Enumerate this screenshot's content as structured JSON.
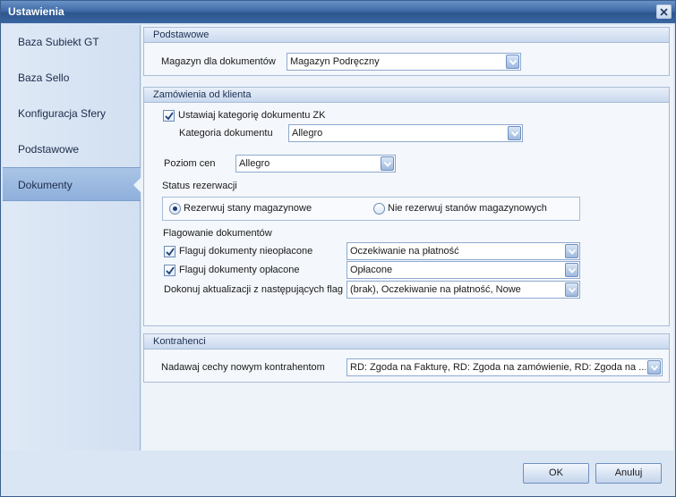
{
  "window": {
    "title": "Ustawienia"
  },
  "sidebar": {
    "items": [
      {
        "label": "Baza Subiekt GT"
      },
      {
        "label": "Baza Sello"
      },
      {
        "label": "Konfiguracja Sfery"
      },
      {
        "label": "Podstawowe"
      },
      {
        "label": "Dokumenty",
        "active": true
      }
    ]
  },
  "podstawowe": {
    "header": "Podstawowe",
    "magazyn_label": "Magazyn dla dokumentów",
    "magazyn_value": "Magazyn Podręczny"
  },
  "zamowienia": {
    "header": "Zamówienia od klienta",
    "ustawiaj_label": "Ustawiaj kategorię dokumentu ZK",
    "ustawiaj_checked": true,
    "kategoria_label": "Kategoria dokumentu",
    "kategoria_value": "Allegro",
    "poziom_label": "Poziom cen",
    "poziom_value": "Allegro",
    "status_label": "Status rezerwacji",
    "radio_rezerwuj": "Rezerwuj stany magazynowe",
    "radio_nie_rezerwuj": "Nie rezerwuj stanów magazynowych",
    "selected_radio": "rezerwuj",
    "flagowanie_label": "Flagowanie dokumentów",
    "nieoplacone_label": "Flaguj dokumenty nieopłacone",
    "nieoplacone_checked": true,
    "nieoplacone_value": "Oczekiwanie na płatność",
    "oplacone_label": "Flaguj dokumenty opłacone",
    "oplacone_checked": true,
    "oplacone_value": "Opłacone",
    "aktualizacja_label": "Dokonuj aktualizacji z następujących flag",
    "aktualizacja_value": "(brak), Oczekiwanie na płatność, Nowe"
  },
  "kontrahenci": {
    "header": "Kontrahenci",
    "cechy_label": "Nadawaj cechy nowym kontrahentom",
    "cechy_value": "RD: Zgoda na Fakturę, RD: Zgoda na zamówienie, RD: Zgoda na ..."
  },
  "footer": {
    "ok_label": "OK",
    "cancel_label": "Anuluj"
  }
}
